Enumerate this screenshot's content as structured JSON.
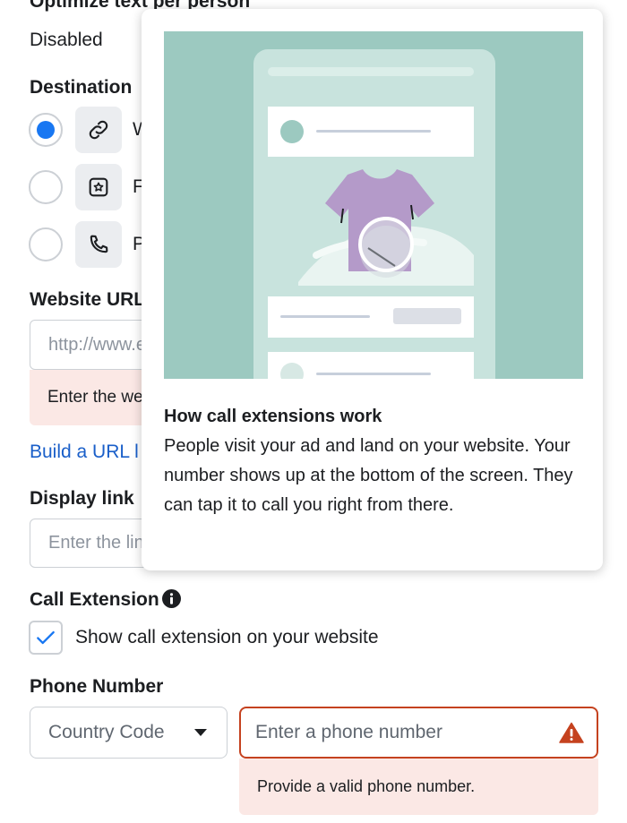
{
  "form": {
    "optimize_label": "Optimize text per person",
    "optimize_value": "Disabled",
    "destination_label": "Destination",
    "destination_options": [
      {
        "icon": "link-icon",
        "label": "W",
        "selected": true
      },
      {
        "icon": "star-box-icon",
        "label": "F",
        "selected": false
      },
      {
        "icon": "phone-icon",
        "label": "P",
        "selected": false
      }
    ],
    "website_url_label": "Website URL",
    "website_url_placeholder": "http://www.e",
    "website_url_error": "Enter the we",
    "build_url_link": "Build a URL l",
    "display_link_label": "Display link",
    "display_link_placeholder": "Enter the link",
    "call_extension_label": "Call Extension",
    "call_extension_checkbox_label": "Show call extension on your website",
    "call_extension_checked": true,
    "phone_number_label": "Phone Number",
    "country_code_value": "Country Code",
    "phone_placeholder": "Enter a phone number",
    "phone_error": "Provide a valid phone number."
  },
  "tooltip": {
    "title": "How call extensions work",
    "body": "People visit your ad and land on your website. Your number shows up at the bottom of the screen. They can tap it to call you right from there."
  },
  "colors": {
    "accent": "#1877f2",
    "link": "#1a5fc9",
    "error_border": "#c5421f",
    "error_bg": "#fbe8e5",
    "illustration_bg": "#9cc9c0",
    "shirt": "#b49ac9"
  }
}
